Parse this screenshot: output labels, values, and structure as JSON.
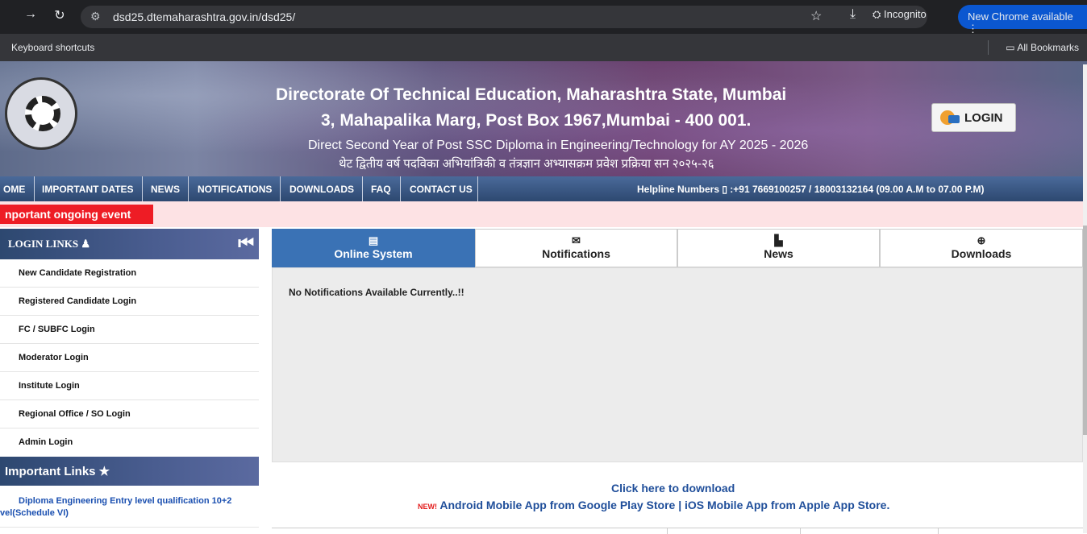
{
  "browser": {
    "url": "dsd25.dtemaharashtra.gov.in/dsd25/",
    "incognito_label": "Incognito",
    "update_label": "New Chrome available",
    "bookmark_shortcuts": "Keyboard shortcuts",
    "all_bookmarks": "All Bookmarks"
  },
  "banner": {
    "title": "Directorate Of Technical Education, Maharashtra State, Mumbai",
    "address": "3, Mahapalika Marg, Post Box 1967,Mumbai - 400 001.",
    "course": "Direct Second Year of Post SSC Diploma in Engineering/Technology for AY 2025 - 2026",
    "course_marathi": "थेट द्वितीय वर्ष पदविका अभियांत्रिकी व तंत्रज्ञान अभ्यासक्रम प्रवेश प्रक्रिया सन २०२५-२६",
    "login_label": "LOGIN"
  },
  "nav": {
    "items": [
      "OME",
      "IMPORTANT DATES",
      "NEWS",
      "NOTIFICATIONS",
      "DOWNLOADS",
      "FAQ",
      "CONTACT US"
    ],
    "helpline": "Helpline Numbers ▯ :+91 7669100257 / 18003132164    (09.00 A.M to 07.00 P.M)"
  },
  "ticker": {
    "label": "nportant ongoing event"
  },
  "sidebar": {
    "login_heading": "LOGIN LINKS",
    "login_items": [
      "New Candidate Registration",
      "Registered Candidate Login",
      "FC / SUBFC Login",
      "Moderator Login",
      "Institute Login",
      "Regional Office / SO Login",
      "Admin Login"
    ],
    "important_heading": "Important Links ★",
    "important_link_line1": "Diploma Engineering Entry level qualification 10+2",
    "important_link_line2": "vel(Schedule VI)"
  },
  "tabs": [
    {
      "icon": "▤",
      "label": "Online System"
    },
    {
      "icon": "✉",
      "label": "Notifications"
    },
    {
      "icon": "▙",
      "label": "News"
    },
    {
      "icon": "⊕",
      "label": "Downloads"
    }
  ],
  "panel": {
    "message": "No Notifications Available Currently..!!"
  },
  "download": {
    "heading": "Click here to download",
    "new_badge": "NEW!",
    "android": "Android Mobile App from Google Play Store |",
    "ios": "iOS Mobile App from Apple App Store."
  },
  "colors": {
    "nav_bg": "#2d4870",
    "tab_active": "#3a72b5",
    "ticker_label": "#ee1c25",
    "link": "#1f4e9a"
  }
}
